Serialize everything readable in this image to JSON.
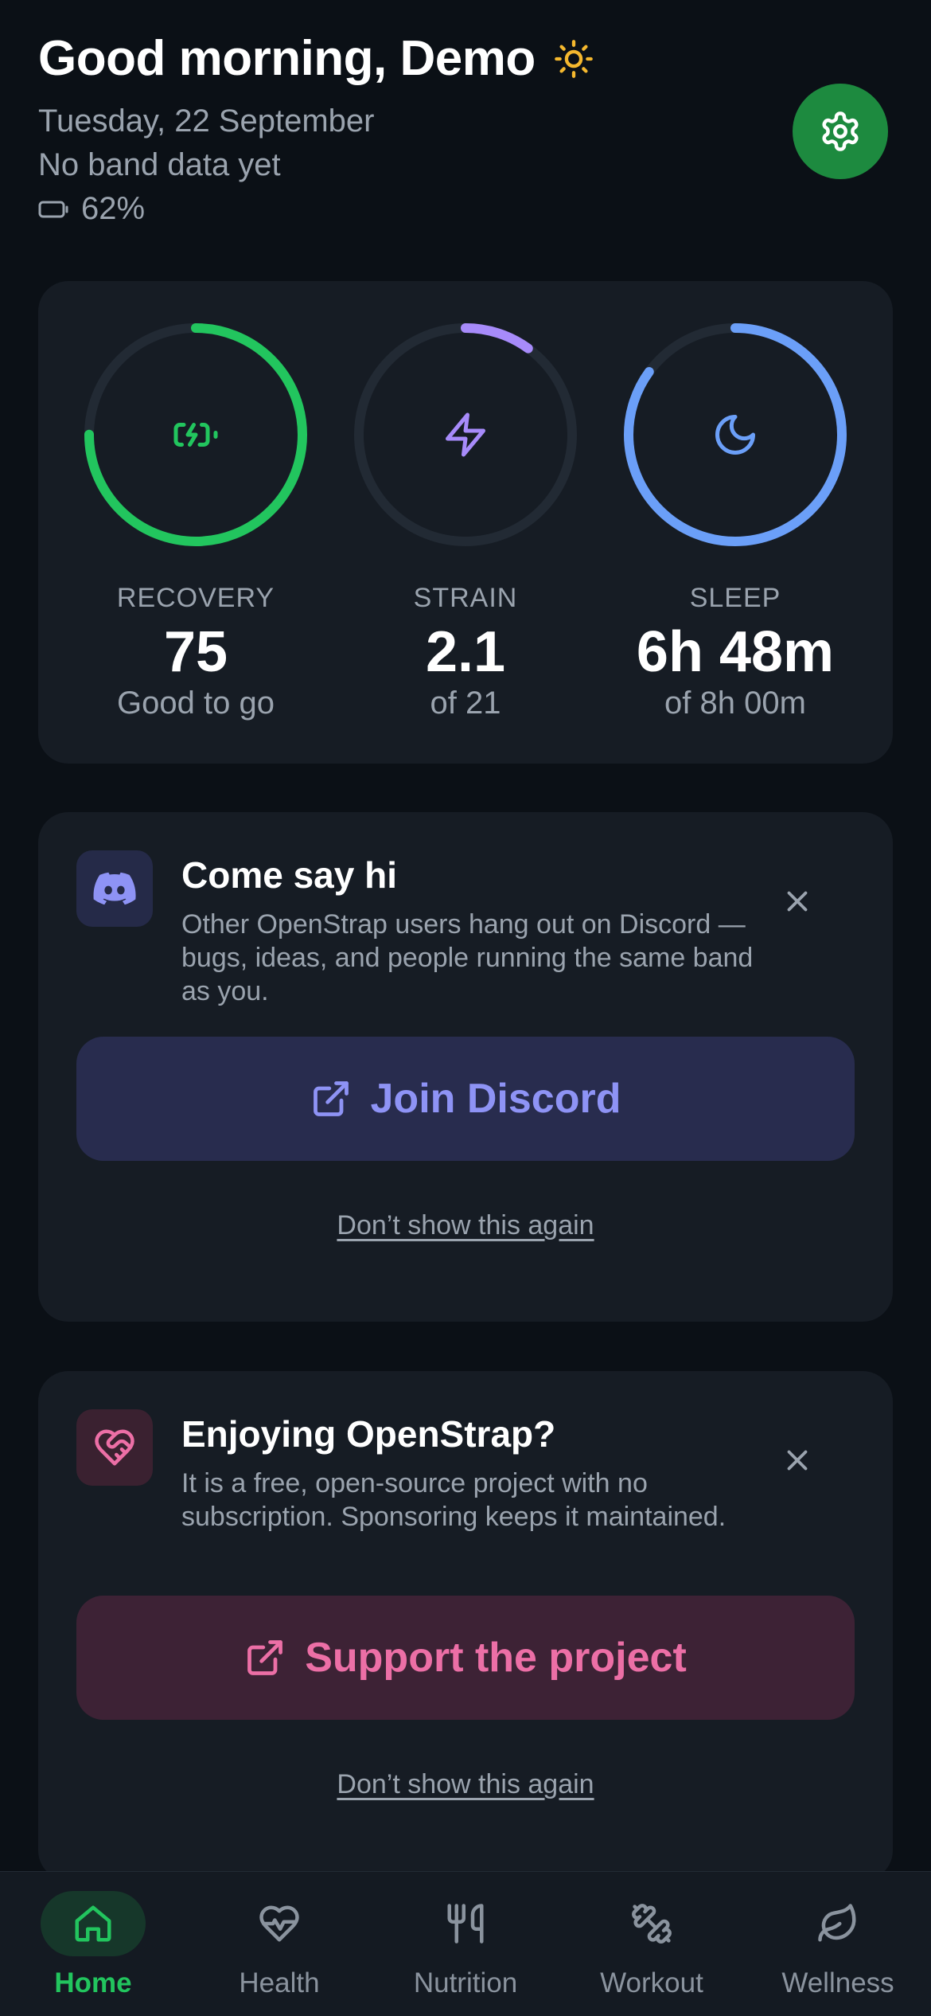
{
  "header": {
    "greeting": "Good morning, Demo",
    "date": "Tuesday, 22 September",
    "band_status": "No band data yet",
    "battery": "62%"
  },
  "metrics": [
    {
      "label": "RECOVERY",
      "value": "75",
      "sub": "Good to go",
      "color": "#22c55e",
      "progress": 0.75,
      "icon": "battery-charging-icon"
    },
    {
      "label": "STRAIN",
      "value": "2.1",
      "sub": "of 21",
      "color": "#a78bfa",
      "progress": 0.1,
      "icon": "lightning-icon"
    },
    {
      "label": "SLEEP",
      "value": "6h 48m",
      "sub": "of 8h 00m",
      "color": "#6b9ff8",
      "progress": 0.85,
      "icon": "moon-icon"
    }
  ],
  "discord_card": {
    "title": "Come say hi",
    "description": "Other OpenStrap users hang out on Discord — bugs, ideas, and people running the same band as you.",
    "button": "Join Discord",
    "dismiss": "Don’t show this again"
  },
  "support_card": {
    "title": "Enjoying OpenStrap?",
    "description": "It is a free, open-source project with no subscription. Sponsoring keeps it maintained.",
    "button": "Support the project",
    "dismiss": "Don’t show this again"
  },
  "nav": [
    {
      "label": "Home",
      "icon": "home-icon",
      "active": true
    },
    {
      "label": "Health",
      "icon": "heart-pulse-icon",
      "active": false
    },
    {
      "label": "Nutrition",
      "icon": "utensils-icon",
      "active": false
    },
    {
      "label": "Workout",
      "icon": "dumbbell-icon",
      "active": false
    },
    {
      "label": "Wellness",
      "icon": "leaf-icon",
      "active": false
    }
  ],
  "colors": {
    "background": "#0b1016",
    "card": "#161c24",
    "accent_green": "#22c55e",
    "settings_button": "#1d8a3f",
    "discord": "#8e93f5",
    "support": "#ec6fa6"
  }
}
